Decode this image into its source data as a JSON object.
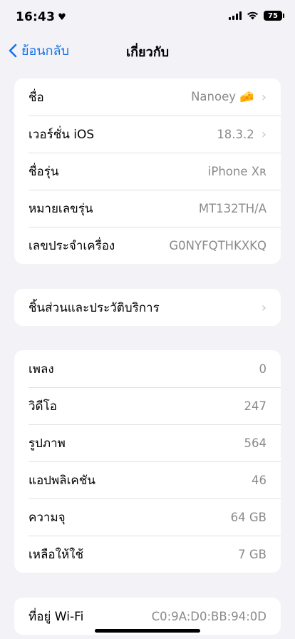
{
  "status_bar": {
    "time": "16:43",
    "battery": "75"
  },
  "nav": {
    "back_label": "ย้อนกลับ",
    "title": "เกี่ยวกับ"
  },
  "group1": [
    {
      "label": "ชื่อ",
      "value": "Nanoey 🧀",
      "chevron": true
    },
    {
      "label": "เวอร์ชั่น iOS",
      "value": "18.3.2",
      "chevron": true
    },
    {
      "label": "ชื่อรุ่น",
      "value": "iPhone Xʀ",
      "chevron": false
    },
    {
      "label": "หมายเลขรุ่น",
      "value": "MT132TH/A",
      "chevron": false
    },
    {
      "label": "เลขประจำเครื่อง",
      "value": "G0NYFQTHKXKQ",
      "chevron": false
    }
  ],
  "group2": [
    {
      "label": "ชิ้นส่วนและประวัติบริการ",
      "value": "",
      "chevron": true
    }
  ],
  "group3": [
    {
      "label": "เพลง",
      "value": "0"
    },
    {
      "label": "วิดีโอ",
      "value": "247"
    },
    {
      "label": "รูปภาพ",
      "value": "564"
    },
    {
      "label": "แอปพลิเคชัน",
      "value": "46"
    },
    {
      "label": "ความจุ",
      "value": "64 GB"
    },
    {
      "label": "เหลือให้ใช้",
      "value": "7 GB"
    }
  ],
  "group4": [
    {
      "label": "ที่อยู่ Wi-Fi",
      "value": "C0:9A:D0:BB:94:0D"
    }
  ]
}
